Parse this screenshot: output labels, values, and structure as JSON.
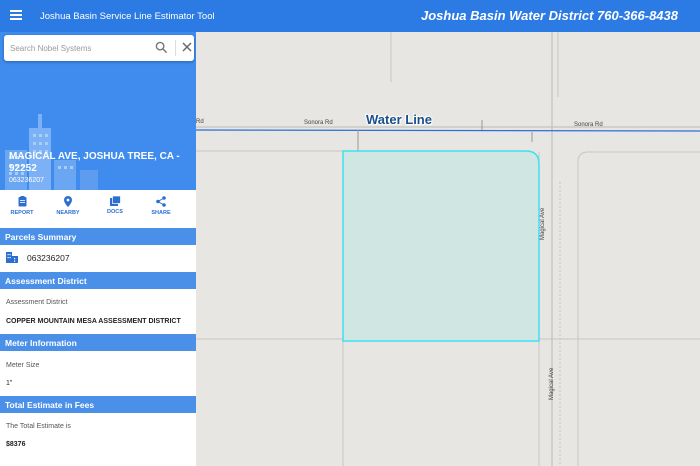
{
  "header": {
    "app_title": "Joshua Basin Service Line Estimator Tool",
    "district": "Joshua Basin Water District  760-366-8438"
  },
  "search": {
    "placeholder": "Search Nobel Systems"
  },
  "property": {
    "address": "MAGICAL AVE, JOSHUA TREE, CA - 92252",
    "parcel_id": "063236207"
  },
  "actions": [
    {
      "label": "REPORT",
      "icon": "report-icon"
    },
    {
      "label": "NEARBY",
      "icon": "location-pin-icon"
    },
    {
      "label": "DOCS",
      "icon": "docs-icon"
    },
    {
      "label": "SHARE",
      "icon": "share-icon"
    }
  ],
  "parcels_summary": {
    "title": "Parcels Summary",
    "parcel": "063236207"
  },
  "assessment": {
    "title": "Assessment District",
    "label": "Assessment District",
    "value": "COPPER MOUNTAIN MESA ASSESSMENT DISTRICT"
  },
  "meter": {
    "title": "Meter Information",
    "label": "Meter Size",
    "value": "1\""
  },
  "estimate": {
    "title": "Total Estimate in Fees",
    "label": "The Total Estimate is",
    "value": "$8376"
  },
  "map": {
    "water_line_label": "Water Line",
    "roads": {
      "rd_left": "Rd",
      "sonora_1": "Sonora Rd",
      "sonora_2": "Sonora Rd",
      "magical_1": "Magical Ave",
      "magical_2": "Magical Ave"
    }
  },
  "colors": {
    "header": "#2c7be5",
    "section": "#4a90e8",
    "parcel_fill": "#cfe6e3",
    "parcel_stroke": "#3ee0f0",
    "water_line": "#2d6fd6"
  }
}
